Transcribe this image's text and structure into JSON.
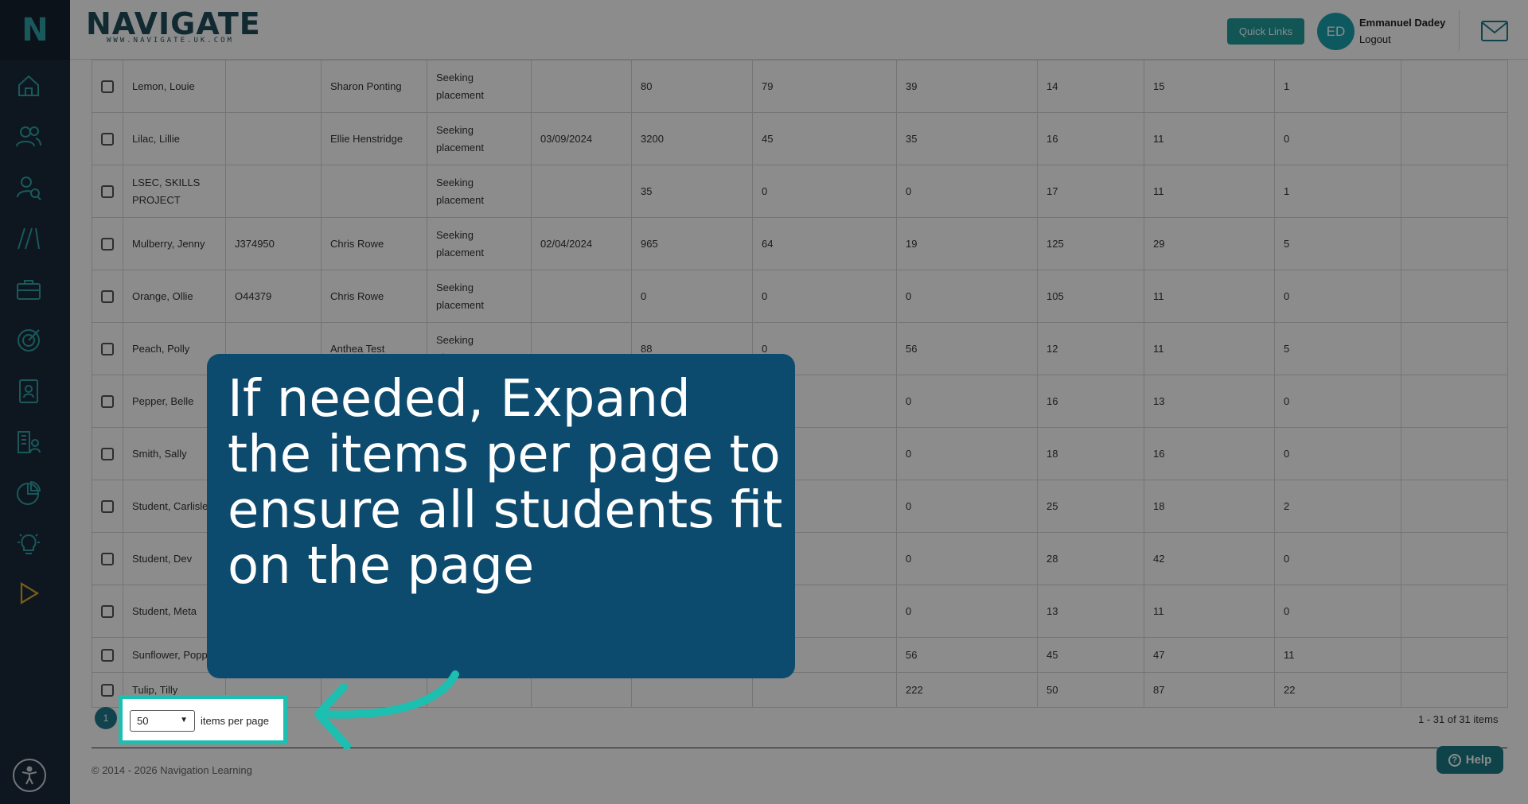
{
  "sidebar": {
    "logo": "N",
    "items": [
      {
        "icon": "home-icon"
      },
      {
        "icon": "users-icon"
      },
      {
        "icon": "user-search-icon"
      },
      {
        "icon": "pathways-icon"
      },
      {
        "icon": "briefcase-icon"
      },
      {
        "icon": "target-icon"
      },
      {
        "icon": "contact-card-icon"
      },
      {
        "icon": "organisation-icon"
      },
      {
        "icon": "pie-chart-icon"
      },
      {
        "icon": "lightbulb-icon"
      },
      {
        "icon": "play-icon"
      }
    ],
    "accessibility_icon": "accessibility-icon"
  },
  "header": {
    "brand_name": "NAVIGATE",
    "brand_url": "WWW.NAVIGATE.UK.COM",
    "quick_links": "Quick Links",
    "avatar_initials": "ED",
    "user_name": "Emmanuel Dadey",
    "logout": "Logout"
  },
  "table": {
    "rows": [
      {
        "name": "Lemon, Louie",
        "id": "",
        "advisor": "Sharon Ponting",
        "status": "Seeking placement",
        "date": "",
        "c1": "80",
        "c2": "79",
        "c3": "39",
        "c4": "14",
        "c5": "15",
        "c6": "1"
      },
      {
        "name": "Lilac, Lillie",
        "id": "",
        "advisor": "Ellie Henstridge",
        "status": "Seeking placement",
        "date": "03/09/2024",
        "c1": "3200",
        "c2": "45",
        "c3": "35",
        "c4": "16",
        "c5": "11",
        "c6": "0"
      },
      {
        "name": "LSEC, SKILLS PROJECT",
        "id": "",
        "advisor": "",
        "status": "Seeking placement",
        "date": "",
        "c1": "35",
        "c2": "0",
        "c3": "0",
        "c4": "17",
        "c5": "11",
        "c6": "1"
      },
      {
        "name": "Mulberry, Jenny",
        "id": "J374950",
        "advisor": "Chris Rowe",
        "status": "Seeking placement",
        "date": "02/04/2024",
        "c1": "965",
        "c2": "64",
        "c3": "19",
        "c4": "125",
        "c5": "29",
        "c6": "5"
      },
      {
        "name": "Orange, Ollie",
        "id": "O44379",
        "advisor": "Chris Rowe",
        "status": "Seeking placement",
        "date": "",
        "c1": "0",
        "c2": "0",
        "c3": "0",
        "c4": "105",
        "c5": "11",
        "c6": "0"
      },
      {
        "name": "Peach, Polly",
        "id": "",
        "advisor": "Anthea Test",
        "status": "Seeking placement",
        "date": "",
        "c1": "88",
        "c2": "0",
        "c3": "56",
        "c4": "12",
        "c5": "11",
        "c6": "5"
      },
      {
        "name": "Pepper, Belle",
        "id": "",
        "advisor": "",
        "status": "",
        "date": "",
        "c1": "",
        "c2": "",
        "c3": "0",
        "c4": "16",
        "c5": "13",
        "c6": "0"
      },
      {
        "name": "Smith, Sally",
        "id": "",
        "advisor": "",
        "status": "",
        "date": "",
        "c1": "",
        "c2": "",
        "c3": "0",
        "c4": "18",
        "c5": "16",
        "c6": "0"
      },
      {
        "name": "Student, Carlisle",
        "id": "",
        "advisor": "",
        "status": "",
        "date": "",
        "c1": "",
        "c2": "",
        "c3": "0",
        "c4": "25",
        "c5": "18",
        "c6": "2"
      },
      {
        "name": "Student, Dev",
        "id": "",
        "advisor": "",
        "status": "",
        "date": "",
        "c1": "",
        "c2": "",
        "c3": "0",
        "c4": "28",
        "c5": "42",
        "c6": "0"
      },
      {
        "name": "Student, Meta",
        "id": "",
        "advisor": "",
        "status": "",
        "date": "",
        "c1": "",
        "c2": "",
        "c3": "0",
        "c4": "13",
        "c5": "11",
        "c6": "0"
      },
      {
        "name": "Sunflower, Poppy",
        "id": "",
        "advisor": "",
        "status": "",
        "date": "",
        "c1": "",
        "c2": "",
        "c3": "56",
        "c4": "45",
        "c5": "47",
        "c6": "11"
      },
      {
        "name": "Tulip, Tilly",
        "id": "",
        "advisor": "",
        "status": "",
        "date": "",
        "c1": "",
        "c2": "",
        "c3": "222",
        "c4": "50",
        "c5": "87",
        "c6": "22"
      }
    ]
  },
  "pager": {
    "current_page": "1",
    "page_size": "50",
    "items_per_page_label": "items per page",
    "items_count": "1 - 31 of 31 items"
  },
  "footer": {
    "copyright": "© 2014 - 2026 Navigation Learning",
    "help": "Help"
  },
  "callout": {
    "text": "If needed, Expand the items per page to ensure all students fit on the page"
  },
  "colors": {
    "sidebar_bg": "#1b2a3a",
    "accent_teal": "#1f9b9c",
    "highlight": "#1cbfb0",
    "callout_bg": "#0c4a6e",
    "play_icon": "#e0a72a"
  }
}
